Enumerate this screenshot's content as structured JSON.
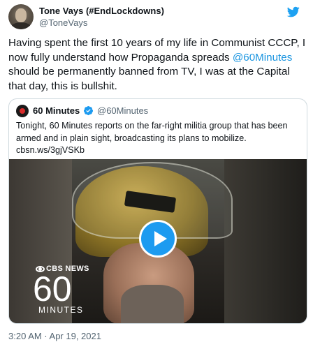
{
  "tweet": {
    "author_name": "Tone Vays (#EndLockdowns)",
    "author_handle": "@ToneVays",
    "text_before": "Having spent the first 10 years of my life in Communist CCCP, I now fully understand how Propaganda spreads ",
    "mention": "@60Minutes",
    "text_after": " should be permanently banned from TV, I was at the Capital that day, this is bullshit.",
    "timestamp": "3:20 AM · Apr 19, 2021",
    "icon": "twitter-bird-icon",
    "accent_color": "#1b95e0"
  },
  "quoted": {
    "author_name": "60 Minutes",
    "author_handle": "@60Minutes",
    "verified_icon": "verified-badge-icon",
    "text_line1": "Tonight, 60 Minutes reports on the far-right militia group that has been armed and in plain sight, broadcasting its plans to mobilize.",
    "link": "cbsn.ws/3gjVSKb",
    "media": {
      "type": "video",
      "play_icon": "play-icon",
      "logo_network": "CBS NEWS",
      "logo_number": "60",
      "logo_word": "MINUTES"
    }
  }
}
